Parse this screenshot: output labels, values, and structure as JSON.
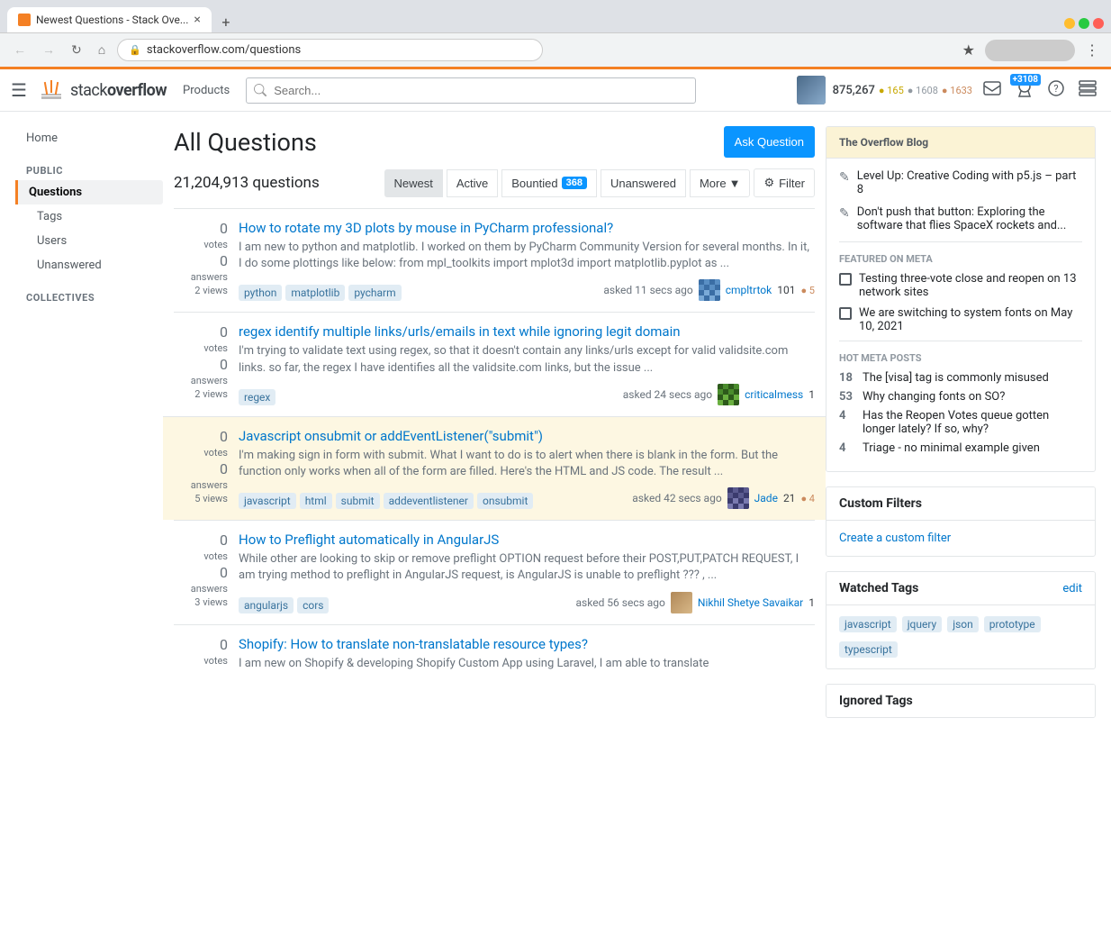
{
  "browser": {
    "tab_title": "Newest Questions - Stack Ove...",
    "url": "stackoverflow.com/questions",
    "new_tab_icon": "+",
    "close_tab": "×"
  },
  "header": {
    "logo_text_gray": "stack",
    "logo_text_dark": "overflow",
    "nav_products": "Products",
    "search_placeholder": "Search...",
    "user_rep": "875,267",
    "gold_count": "165",
    "silver_count": "1608",
    "bronze_count": "1633",
    "notification_badge": "+3108"
  },
  "page": {
    "title": "All Questions",
    "ask_button": "Ask Question",
    "questions_count": "21,204,913 questions",
    "tabs": [
      {
        "label": "Newest",
        "active": true
      },
      {
        "label": "Active",
        "active": false
      },
      {
        "label": "Bountied",
        "active": false,
        "badge": "368"
      },
      {
        "label": "Unanswered",
        "active": false
      },
      {
        "label": "More",
        "active": false,
        "has_arrow": true
      }
    ],
    "filter_button": "Filter"
  },
  "questions": [
    {
      "id": "q1",
      "votes": "0",
      "answers": "0",
      "views": "2 views",
      "title": "How to rotate my 3D plots by mouse in PyCharm professional?",
      "excerpt": "I am new to python and matplotlib. I worked on them by PyCharm Community Version for several months. In it, I do some plottings like below: from mpl_toolkits import mplot3d import matplotlib.pyplot as ...",
      "tags": [
        "python",
        "matplotlib",
        "pycharm"
      ],
      "asked_time": "asked 11 secs ago",
      "user_name": "cmpltrtok",
      "user_score": "101",
      "user_bronze": "5",
      "avatar_class": "avatar-cmpltrtok",
      "highlighted": false
    },
    {
      "id": "q2",
      "votes": "0",
      "answers": "0",
      "views": "2 views",
      "title": "regex identify multiple links/urls/emails in text while ignoring legit domain",
      "excerpt": "I'm trying to validate text using regex, so that it doesn't contain any links/urls except for valid validsite.com links. so far, the regex I have identifies all the validsite.com links, but the issue ...",
      "tags": [
        "regex"
      ],
      "asked_time": "asked 24 secs ago",
      "user_name": "criticalmess",
      "user_score": "1",
      "user_bronze": "",
      "avatar_class": "avatar-criticalmess",
      "highlighted": false
    },
    {
      "id": "q3",
      "votes": "0",
      "answers": "0",
      "views": "5 views",
      "title": "Javascript onsubmit or addEventListener(\"submit\")",
      "excerpt": "I'm making sign in form with submit. What I want to do is to alert when there is blank in the form. But the function only works when all of the form are filled. Here's the HTML and JS code. The result ...",
      "tags": [
        "javascript",
        "html",
        "submit",
        "addeventlistener",
        "onsubmit"
      ],
      "asked_time": "asked 42 secs ago",
      "user_name": "Jade",
      "user_score": "21",
      "user_bronze": "4",
      "avatar_class": "avatar-jade",
      "highlighted": true
    },
    {
      "id": "q4",
      "votes": "0",
      "answers": "0",
      "views": "3 views",
      "title": "How to Preflight automatically in AngularJS",
      "excerpt": "While other are looking to skip or remove preflight OPTION request before their POST,PUT,PATCH REQUEST, I am trying method to preflight in AngularJS request, is AngularJS is unable to preflight ??? , ...",
      "tags": [
        "angularjs",
        "cors"
      ],
      "asked_time": "asked 56 secs ago",
      "user_name": "Nikhil Shetye Savaikar",
      "user_score": "1",
      "user_bronze": "",
      "avatar_class": "avatar-nikhil",
      "highlighted": false
    },
    {
      "id": "q5",
      "votes": "0",
      "answers": "",
      "views": "",
      "title": "Shopify: How to translate non-translatable resource types?",
      "excerpt": "I am new on Shopify & developing Shopify Custom App using Laravel, I am able to translate",
      "tags": [],
      "asked_time": "",
      "user_name": "",
      "user_score": "",
      "user_bronze": "",
      "avatar_class": "avatar-user",
      "highlighted": false
    }
  ],
  "sidebar": {
    "overflow_blog_title": "The Overflow Blog",
    "blog_posts": [
      {
        "text": "Level Up: Creative Coding with p5.js – part 8"
      },
      {
        "text": "Don't push that button: Exploring the software that flies SpaceX rockets and..."
      }
    ],
    "featured_meta_title": "Featured on Meta",
    "featured_items": [
      {
        "text": "Testing three-vote close and reopen on 13 network sites"
      },
      {
        "text": "We are switching to system fonts on May 10, 2021"
      }
    ],
    "hot_meta_title": "Hot Meta Posts",
    "hot_items": [
      {
        "num": "18",
        "text": "The [visa] tag is commonly misused"
      },
      {
        "num": "53",
        "text": "Why changing fonts on SO?"
      },
      {
        "num": "4",
        "text": "Has the Reopen Votes queue gotten longer lately? If so, why?"
      },
      {
        "num": "4",
        "text": "Triage - no minimal example given"
      }
    ],
    "custom_filters_title": "Custom Filters",
    "create_filter_link": "Create a custom filter",
    "watched_tags_title": "Watched Tags",
    "watched_tags_edit": "edit",
    "watched_tags": [
      "javascript",
      "jquery",
      "json",
      "prototype",
      "typescript"
    ],
    "ignored_tags_title": "Ignored Tags"
  },
  "left_nav": {
    "items": [
      {
        "label": "Home",
        "indent": false
      },
      {
        "label": "Questions",
        "active": true,
        "indent": false
      },
      {
        "label": "Tags",
        "indent": false
      },
      {
        "label": "Users",
        "indent": false
      },
      {
        "label": "Unanswered",
        "indent": false
      }
    ],
    "sections": [
      {
        "title": "COLLECTIVES",
        "items": []
      }
    ]
  }
}
